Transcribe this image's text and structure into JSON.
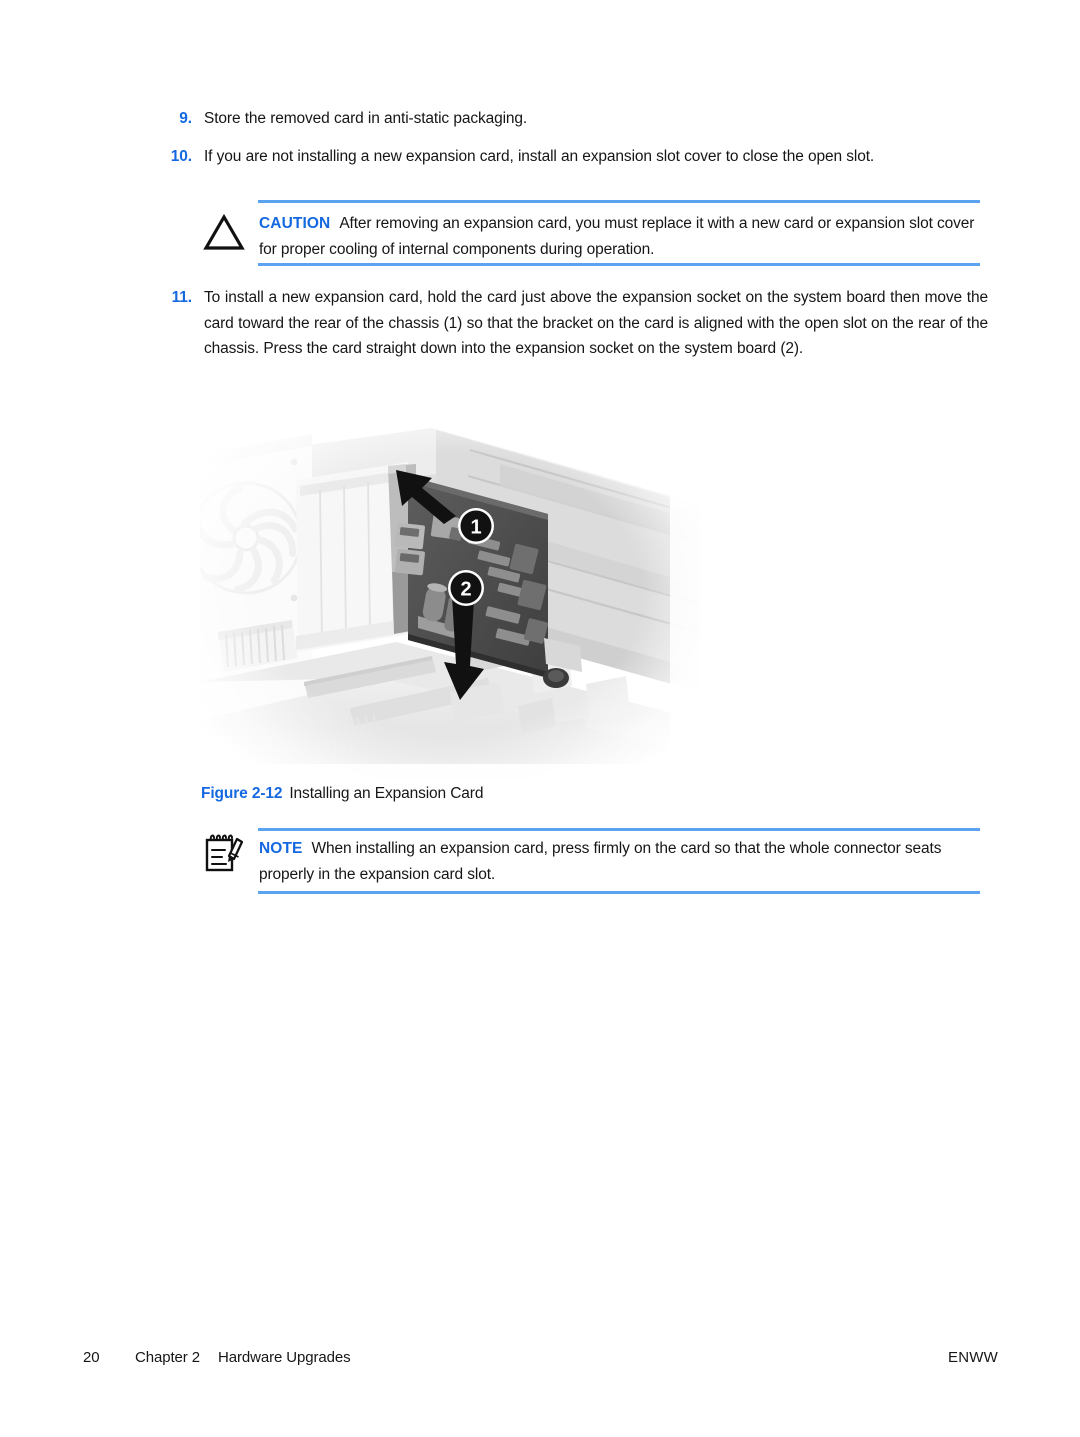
{
  "page": {
    "steps": [
      {
        "number": "9.",
        "text": "Store the removed card in anti-static packaging."
      },
      {
        "number": "10.",
        "text": "If you are not installing a new expansion card, install an expansion slot cover to close the open slot."
      },
      {
        "number": "11.",
        "text": "To install a new expansion card, hold the card just above the expansion socket on the system board then move the card toward the rear of the chassis (1) so that the bracket on the card is aligned with the open slot on the rear of the chassis. Press the card straight down into the expansion socket on the system board (2)."
      }
    ],
    "caution": {
      "icon": "warning-triangle-icon",
      "label": "CAUTION",
      "text": "After removing an expansion card, you must replace it with a new card or expansion slot cover for proper cooling of internal components during operation."
    },
    "note": {
      "icon": "notepad-pencil-icon",
      "label": "NOTE",
      "text": "When installing an expansion card, press firmly on the card so that the whole connector seats properly in the expansion card slot."
    },
    "figure": {
      "label": "Figure 2-12",
      "title": "Installing an Expansion Card",
      "description": "Grayscale photograph of an open computer chassis showing an expansion card being installed into an expansion socket on the system board, with a chassis fan grille at left and expansion slot covers at the rear.",
      "callouts": [
        {
          "number": "1",
          "meaning": "move the card toward the rear of the chassis"
        },
        {
          "number": "2",
          "meaning": "press the card straight down into the expansion socket"
        }
      ]
    },
    "footer": {
      "page_number": "20",
      "chapter": "Chapter 2",
      "chapter_title": "Hardware Upgrades",
      "locale": "ENWW"
    },
    "colors": {
      "accent_blue": "#1569e0",
      "rule_blue": "#5ba3f0",
      "body_text": "#161616",
      "page_background": "#ffffff"
    }
  }
}
